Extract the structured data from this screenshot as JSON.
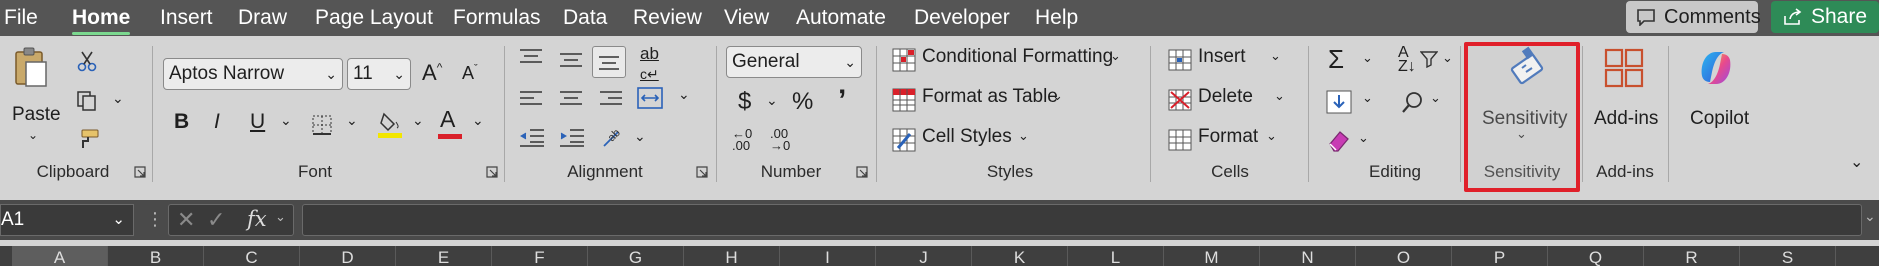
{
  "menu": {
    "items": [
      "File",
      "Home",
      "Insert",
      "Draw",
      "Page Layout",
      "Formulas",
      "Data",
      "Review",
      "View",
      "Automate",
      "Developer",
      "Help"
    ],
    "active": "Home",
    "comments_label": "Comments",
    "share_label": "Share"
  },
  "clipboard": {
    "paste_label": "Paste",
    "group_label": "Clipboard"
  },
  "font": {
    "font_name": "Aptos Narrow",
    "font_size": "11",
    "bold_label": "B",
    "italic_label": "I",
    "underline_label": "U",
    "font_color_label": "A",
    "grow_label": "A",
    "shrink_label": "A",
    "group_label": "Font"
  },
  "alignment": {
    "group_label": "Alignment"
  },
  "number": {
    "format": "General",
    "currency": "$",
    "percent": "%",
    "comma": "’",
    "group_label": "Number",
    "inc_decimal": "←.0 .00",
    "dec_decimal": ".00 →.0"
  },
  "styles": {
    "conditional_formatting": "Conditional Formatting",
    "format_as_table": "Format as Table",
    "cell_styles": "Cell Styles",
    "group_label": "Styles"
  },
  "cells": {
    "insert": "Insert",
    "delete": "Delete",
    "format": "Format",
    "group_label": "Cells"
  },
  "editing": {
    "sum_label": "Σ",
    "group_label": "Editing"
  },
  "sensitivity": {
    "button_label": "Sensitivity",
    "group_label": "Sensitivity"
  },
  "addins": {
    "button_label": "Add-ins",
    "group_label": "Add-ins"
  },
  "copilot": {
    "button_label": "Copilot"
  },
  "formula_bar": {
    "name_box": "A1",
    "fx": "fx",
    "value": ""
  },
  "columns": [
    "A",
    "B",
    "C",
    "D",
    "E",
    "F",
    "G",
    "H",
    "I",
    "J",
    "K",
    "L",
    "M",
    "N",
    "O",
    "P",
    "Q",
    "R",
    "S"
  ],
  "colors": {
    "accent_green": "#2e8b57",
    "highlight_red": "#e0202a",
    "menu_bg": "#555555",
    "ribbon_bg": "#d4d4d4"
  }
}
